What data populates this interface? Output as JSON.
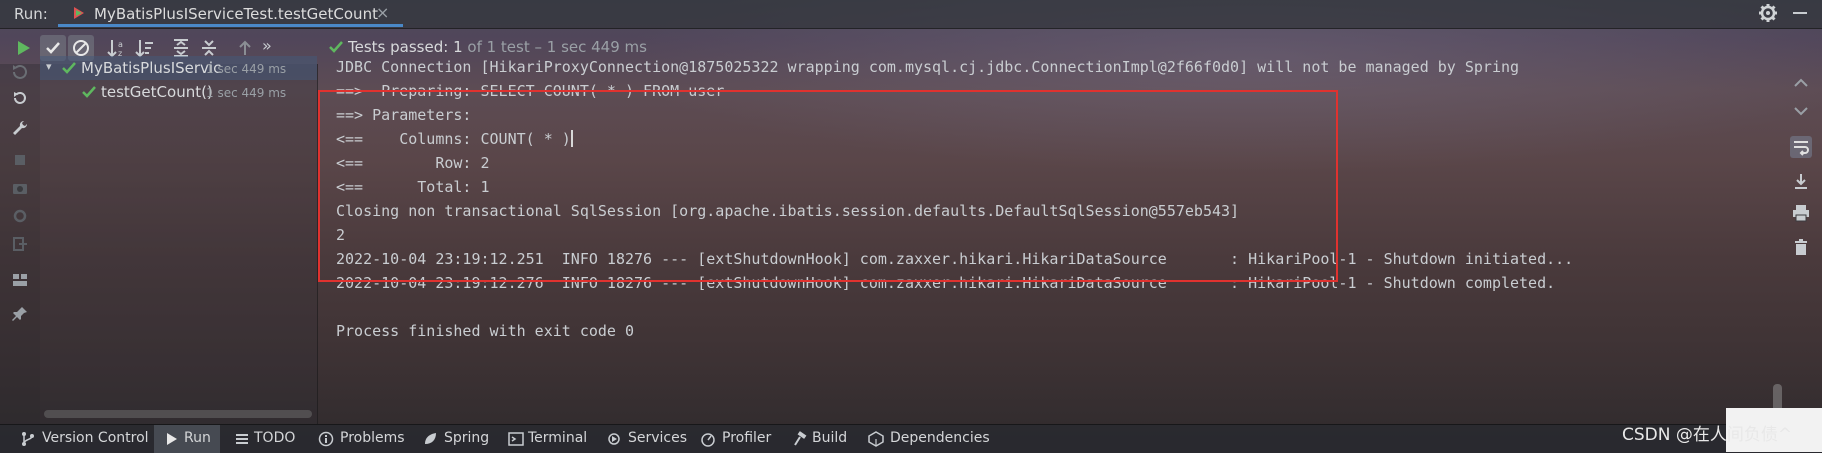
{
  "run_bar": {
    "label": "Run:",
    "tab_title": "MyBatisPlusIServiceTest.testGetCount"
  },
  "toolbar": {
    "status_prefix": "Tests passed:",
    "status_count": "1",
    "status_detail": "of 1 test – 1 sec 449 ms",
    "buttons": [
      "rerun",
      "show-passed",
      "show-ignored",
      "sort-alpha",
      "sort-duration",
      "expand-all",
      "collapse-all",
      "previous-failed",
      "more"
    ]
  },
  "test_tree": {
    "items": [
      {
        "label": "MyBatisPlusIServic",
        "time": "1 sec 449 ms",
        "status": "passed"
      },
      {
        "label": "testGetCount()",
        "time": "1 sec 449 ms",
        "status": "passed"
      }
    ]
  },
  "console": {
    "lines": [
      "JDBC Connection [HikariProxyConnection@1875025322 wrapping com.mysql.cj.jdbc.ConnectionImpl@2f66f0d0] will not be managed by Spring",
      "==>  Preparing: SELECT COUNT( * ) FROM user",
      "==> Parameters: ",
      "<==    Columns: COUNT( * )",
      "<==        Row: 2",
      "<==      Total: 1",
      "Closing non transactional SqlSession [org.apache.ibatis.session.defaults.DefaultSqlSession@557eb543]",
      "2",
      "2022-10-04 23:19:12.251  INFO 18276 --- [extShutdownHook] com.zaxxer.hikari.HikariDataSource       : HikariPool-1 - Shutdown initiated...",
      "2022-10-04 23:19:12.276  INFO 18276 --- [extShutdownHook] com.zaxxer.hikari.HikariDataSource       : HikariPool-1 - Shutdown completed.",
      "",
      "Process finished with exit code 0"
    ]
  },
  "bottom_bar": {
    "items": [
      {
        "label": "Version Control",
        "icon": "branch-icon"
      },
      {
        "label": "Run",
        "icon": "play-icon",
        "active": true
      },
      {
        "label": "TODO",
        "icon": "list-icon"
      },
      {
        "label": "Problems",
        "icon": "info-icon"
      },
      {
        "label": "Spring",
        "icon": "leaf-icon"
      },
      {
        "label": "Terminal",
        "icon": "terminal-icon"
      },
      {
        "label": "Services",
        "icon": "services-icon"
      },
      {
        "label": "Profiler",
        "icon": "profiler-icon"
      },
      {
        "label": "Build",
        "icon": "hammer-icon"
      },
      {
        "label": "Dependencies",
        "icon": "dependencies-icon"
      }
    ]
  },
  "watermark": "CSDN @在人间负债^",
  "colors": {
    "accent": "#4a88c7",
    "pass_green": "#5fb85f",
    "highlight_red": "#e0322f"
  }
}
